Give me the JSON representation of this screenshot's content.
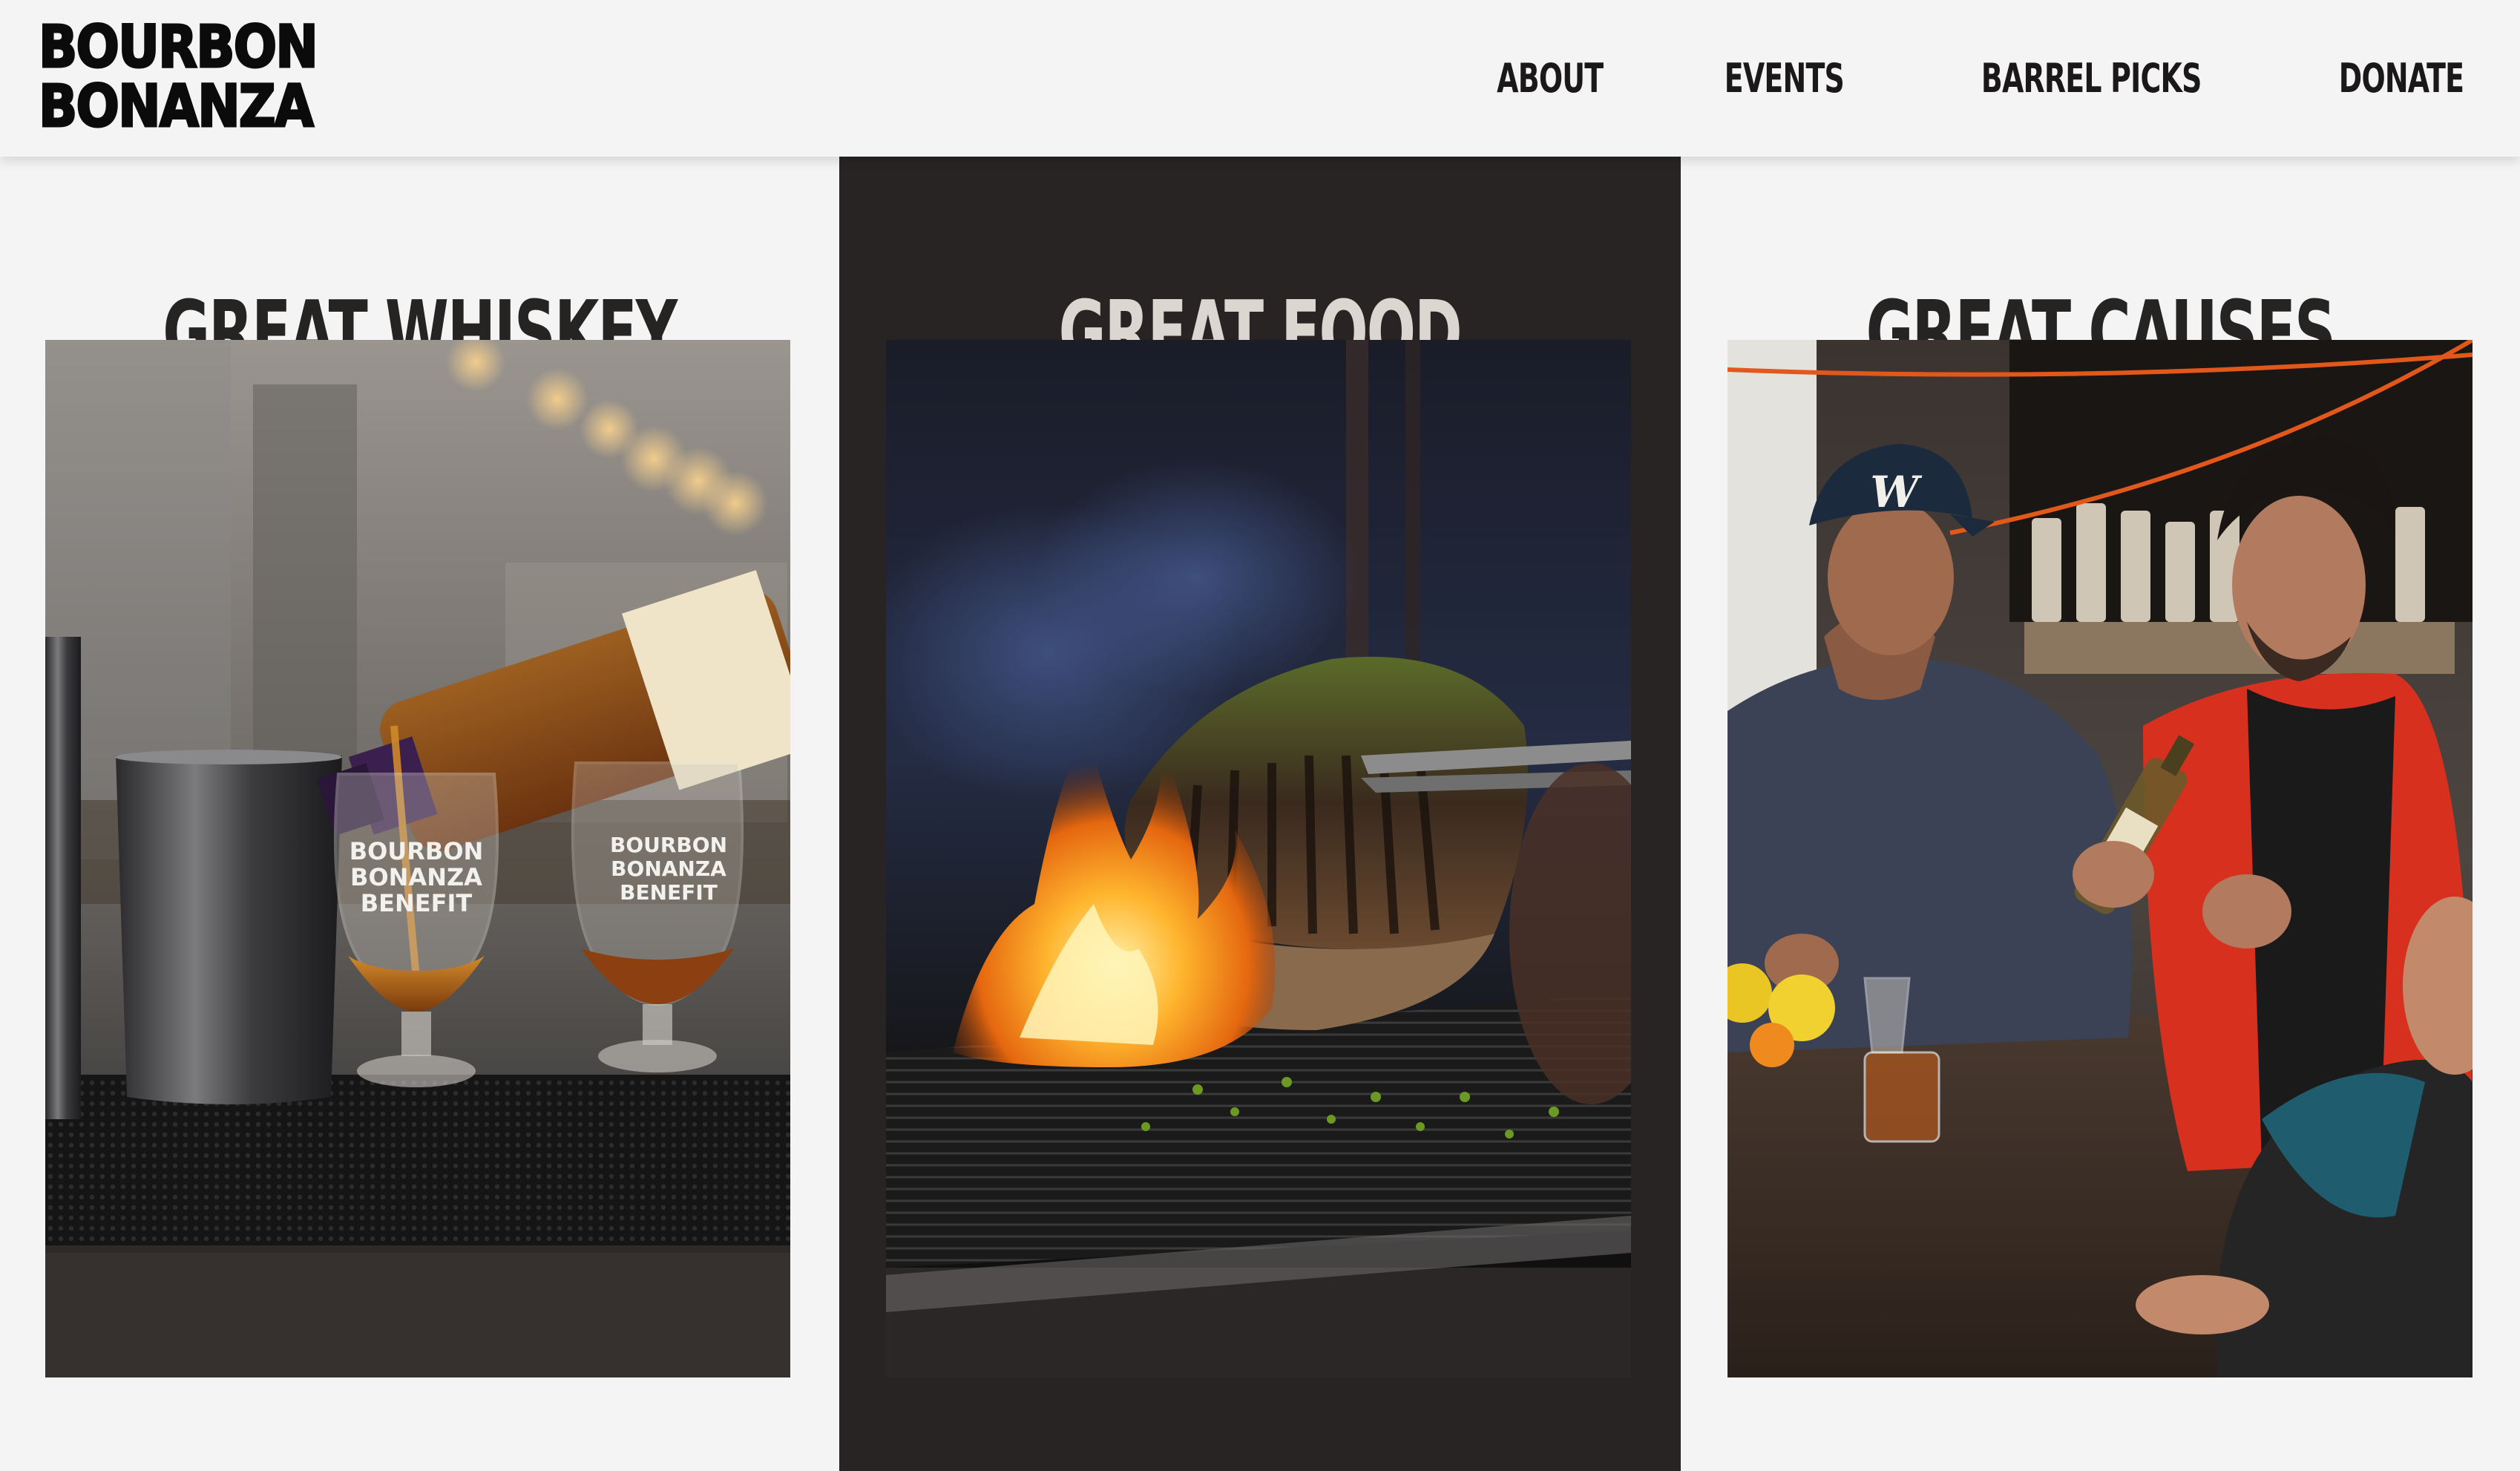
{
  "brand": {
    "logo_line1": "BOURBON",
    "logo_line2": "BONANZA"
  },
  "nav": {
    "items": [
      "ABOUT",
      "EVENTS",
      "BARREL PICKS",
      "DONATE"
    ]
  },
  "columns": [
    {
      "title": "GREAT WHISKEY",
      "photo_alt": "Bourbon being poured into glencairn glasses",
      "glass_text": [
        "BOURBON",
        "BONANZA",
        "BENEFIT"
      ]
    },
    {
      "title": "GREAT FOOD",
      "photo_alt": "Meat grilling over open flames"
    },
    {
      "title": "GREAT CAUSES",
      "photo_alt": "People tasting whiskey at an outdoor table",
      "cap_letter": "W"
    }
  ],
  "colors": {
    "header_bg": "#f4f4f4",
    "panel_light": "#f4f4f4",
    "panel_dark": "#282424",
    "title_dark": "#262323",
    "title_light": "#dcd6d0"
  }
}
